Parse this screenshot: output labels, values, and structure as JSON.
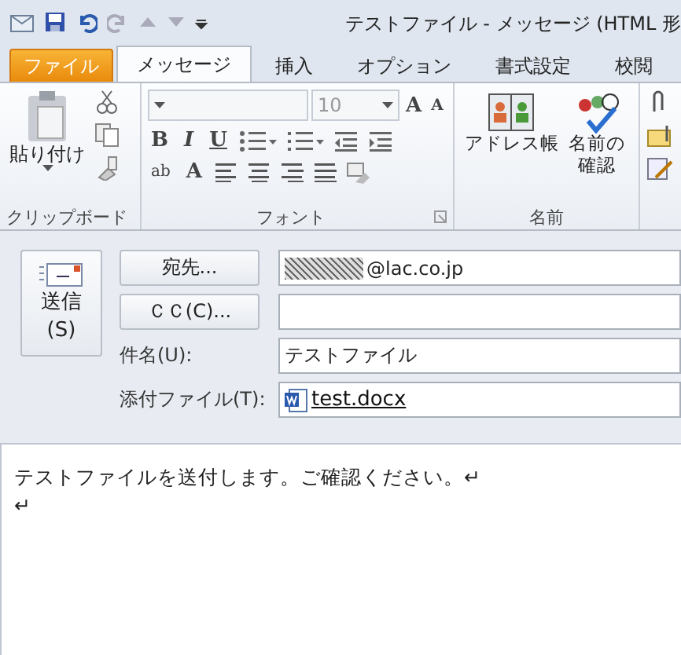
{
  "window": {
    "title": "テストファイル  -  メッセージ (HTML 形"
  },
  "tabs": [
    {
      "label": "ファイル",
      "kind": "file",
      "selected": false
    },
    {
      "label": "メッセージ",
      "kind": "tab",
      "selected": true
    },
    {
      "label": "挿入",
      "kind": "tab",
      "selected": false
    },
    {
      "label": "オプション",
      "kind": "tab",
      "selected": false
    },
    {
      "label": "書式設定",
      "kind": "tab",
      "selected": false
    },
    {
      "label": "校閲",
      "kind": "tab",
      "selected": false
    }
  ],
  "ribbon": {
    "groups": [
      {
        "kind": "clipboard",
        "label": "クリップボード",
        "paste": "貼り付け"
      },
      {
        "kind": "font",
        "label": "フォント",
        "font_size": "10",
        "grow": "A",
        "shrink": "A",
        "styles": [
          "B",
          "I",
          "U"
        ],
        "highlight": "ab",
        "font_color": "A"
      },
      {
        "kind": "names",
        "label": "名前",
        "buttons": [
          {
            "lines": [
              "アドレス帳"
            ]
          },
          {
            "lines": [
              "名前の",
              "確認"
            ]
          }
        ]
      },
      {
        "kind": "include"
      }
    ]
  },
  "send_button": {
    "lines": [
      "送信",
      "(S)"
    ]
  },
  "fields": [
    {
      "kind": "button",
      "label": "宛先...",
      "value": "@lac.co.jp",
      "redacted": true
    },
    {
      "kind": "button",
      "label": "ＣＣ(C)..."
    },
    {
      "kind": "label",
      "label": "件名(U):",
      "value": "テストファイル"
    },
    {
      "kind": "attachment",
      "label": "添付ファイル(T):",
      "file": "test.docx"
    }
  ],
  "body": {
    "paragraphs": [
      "テストファイルを送付します。ご確認ください。↵",
      "↵"
    ]
  }
}
